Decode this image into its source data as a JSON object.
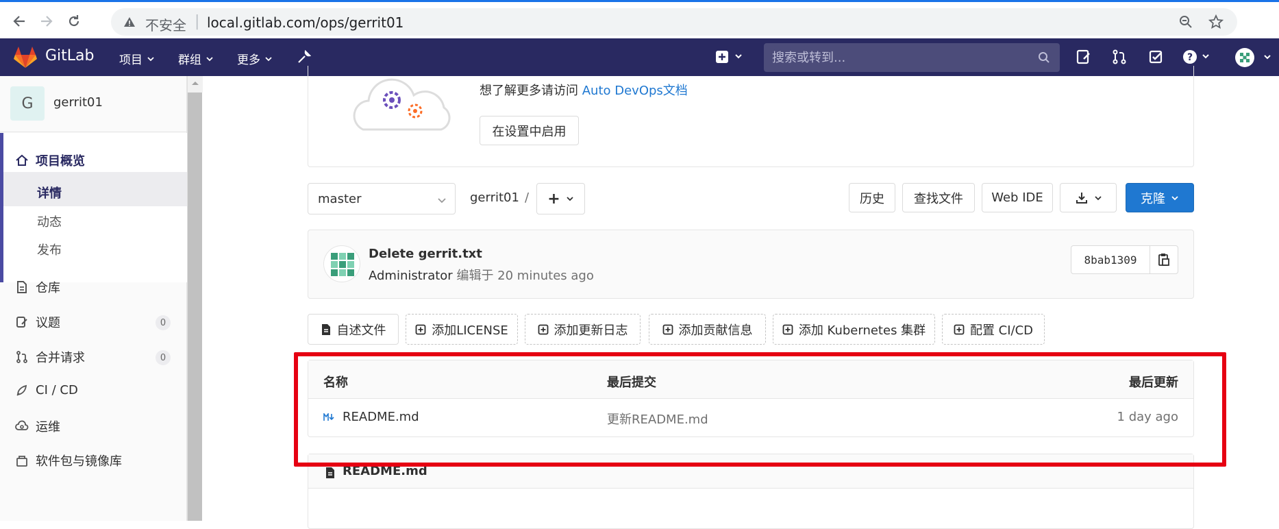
{
  "browser": {
    "insecure_label": "不安全",
    "url": "local.gitlab.com/ops/gerrit01"
  },
  "navbar": {
    "brand": "GitLab",
    "menus": [
      "项目",
      "群组",
      "更多"
    ],
    "search_placeholder": "搜索或转到...",
    "bg_color": "#292961"
  },
  "sidebar": {
    "project_initial": "G",
    "project_name": "gerrit01",
    "overview_label": "项目概览",
    "overview_sub": [
      "详情",
      "动态",
      "发布"
    ],
    "items": [
      {
        "label": "仓库",
        "icon": "doc-icon"
      },
      {
        "label": "议题",
        "icon": "issues-icon",
        "count": "0"
      },
      {
        "label": "合并请求",
        "icon": "merge-request-icon",
        "count": "0"
      },
      {
        "label": "CI / CD",
        "icon": "rocket-icon"
      },
      {
        "label": "运维",
        "icon": "cloud-gear-icon"
      },
      {
        "label": "软件包与镜像库",
        "icon": "package-icon"
      }
    ]
  },
  "autodevops": {
    "text": "想了解更多请访问 ",
    "link": "Auto DevOps文档",
    "enable_button": "在设置中启用"
  },
  "repo_toolbar": {
    "branch": "master",
    "breadcrumb": "gerrit01",
    "separator": "/",
    "add_button": "+",
    "history": "历史",
    "find_file": "查找文件",
    "web_ide": "Web IDE",
    "clone": "克隆"
  },
  "last_commit": {
    "title": "Delete gerrit.txt",
    "author": "Administrator",
    "meta": " 编辑于 20 minutes ago",
    "sha": "8bab1309"
  },
  "quick_actions": [
    "自述文件",
    "添加LICENSE",
    "添加更新日志",
    "添加贡献信息",
    "添加 Kubernetes 集群",
    "配置 CI/CD"
  ],
  "file_table": {
    "headers": {
      "name": "名称",
      "last_commit": "最后提交",
      "last_update": "最后更新"
    },
    "rows": [
      {
        "name": "README.md",
        "commit": "更新README.md",
        "updated": "1 day ago"
      }
    ]
  },
  "readme": {
    "title": "README.md"
  },
  "colors": {
    "accent": "#1f78d1",
    "highlight": "#e60012"
  }
}
